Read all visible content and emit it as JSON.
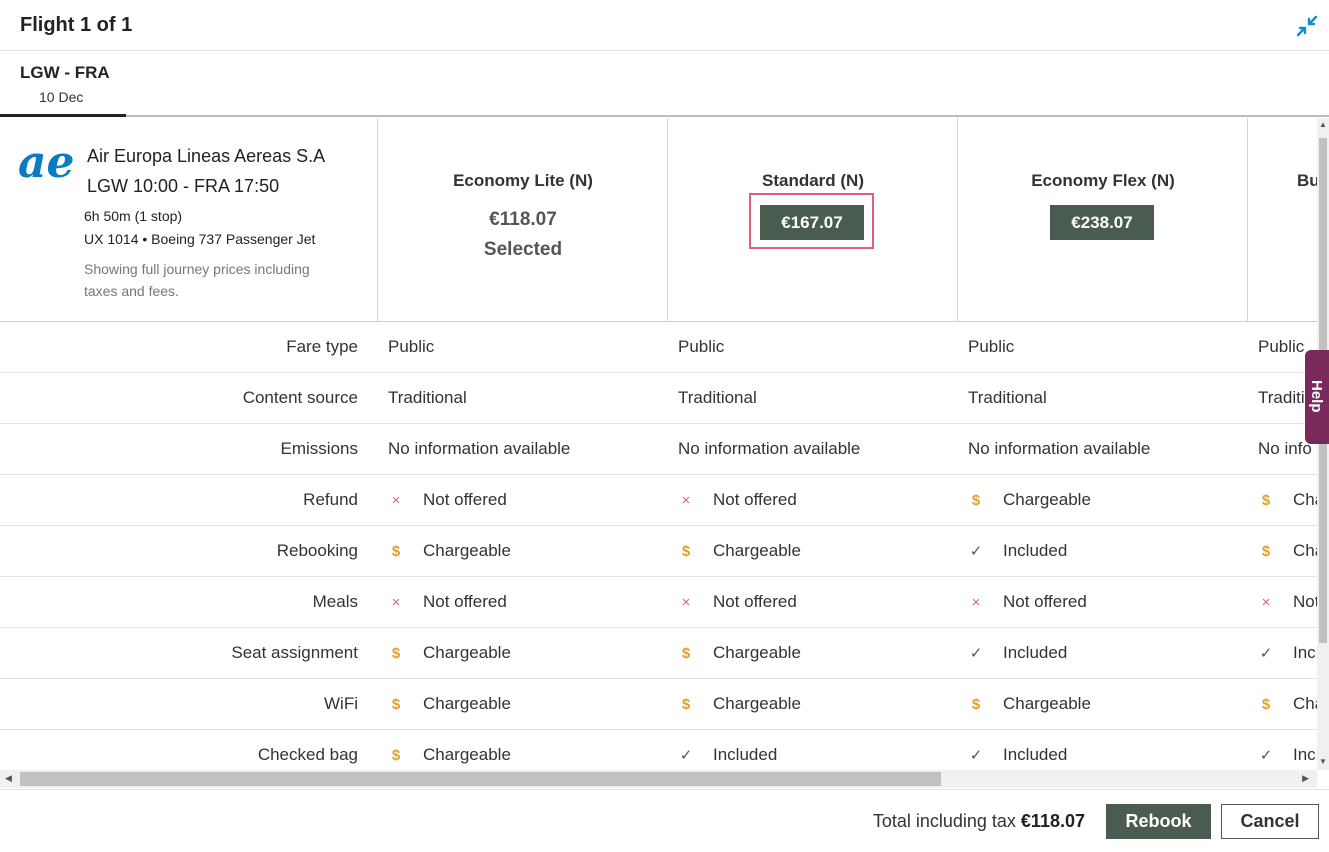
{
  "header": {
    "title": "Flight 1 of 1"
  },
  "tab": {
    "route": "LGW - FRA",
    "date": "10 Dec"
  },
  "flight": {
    "airline": "Air Europa Lineas Aereas S.A",
    "times": "LGW 10:00 - FRA 17:50",
    "duration": "6h 50m (1 stop)",
    "equipment": "UX 1014 • Boeing 737 Passenger Jet",
    "note": "Showing full journey prices including taxes and fees.",
    "logo_text": "ae",
    "logo_color": "#0a7cc4"
  },
  "fares": [
    {
      "name": "Economy Lite (N)",
      "price": "€118.07",
      "status": "Selected"
    },
    {
      "name": "Standard (N)",
      "price": "€167.07"
    },
    {
      "name": "Economy Flex (N)",
      "price": "€238.07"
    },
    {
      "name": "Bu"
    }
  ],
  "rows": [
    {
      "label": "Fare type",
      "cells": [
        {
          "icon": "",
          "text": "Public"
        },
        {
          "icon": "",
          "text": "Public"
        },
        {
          "icon": "",
          "text": "Public"
        },
        {
          "icon": "",
          "text": "Public"
        }
      ]
    },
    {
      "label": "Content source",
      "cells": [
        {
          "icon": "",
          "text": "Traditional"
        },
        {
          "icon": "",
          "text": "Traditional"
        },
        {
          "icon": "",
          "text": "Traditional"
        },
        {
          "icon": "",
          "text": "Traditi"
        }
      ]
    },
    {
      "label": "Emissions",
      "cells": [
        {
          "icon": "",
          "text": "No information available"
        },
        {
          "icon": "",
          "text": "No information available"
        },
        {
          "icon": "",
          "text": "No information available"
        },
        {
          "icon": "",
          "text": "No info"
        }
      ]
    },
    {
      "label": "Refund",
      "cells": [
        {
          "icon": "x",
          "text": "Not offered"
        },
        {
          "icon": "x",
          "text": "Not offered"
        },
        {
          "icon": "d",
          "text": "Chargeable"
        },
        {
          "icon": "d",
          "text": "Cha"
        }
      ]
    },
    {
      "label": "Rebooking",
      "cells": [
        {
          "icon": "d",
          "text": "Chargeable"
        },
        {
          "icon": "d",
          "text": "Chargeable"
        },
        {
          "icon": "c",
          "text": "Included"
        },
        {
          "icon": "d",
          "text": "Cha"
        }
      ]
    },
    {
      "label": "Meals",
      "cells": [
        {
          "icon": "x",
          "text": "Not offered"
        },
        {
          "icon": "x",
          "text": "Not offered"
        },
        {
          "icon": "x",
          "text": "Not offered"
        },
        {
          "icon": "x",
          "text": "Not"
        }
      ]
    },
    {
      "label": "Seat assignment",
      "cells": [
        {
          "icon": "d",
          "text": "Chargeable"
        },
        {
          "icon": "d",
          "text": "Chargeable"
        },
        {
          "icon": "c",
          "text": "Included"
        },
        {
          "icon": "c",
          "text": "Inc"
        }
      ]
    },
    {
      "label": "WiFi",
      "cells": [
        {
          "icon": "d",
          "text": "Chargeable"
        },
        {
          "icon": "d",
          "text": "Chargeable"
        },
        {
          "icon": "d",
          "text": "Chargeable"
        },
        {
          "icon": "d",
          "text": "Cha"
        }
      ]
    },
    {
      "label": "Checked bag",
      "cells": [
        {
          "icon": "d",
          "text": "Chargeable"
        },
        {
          "icon": "c",
          "text": "Included"
        },
        {
          "icon": "c",
          "text": "Included"
        },
        {
          "icon": "c",
          "text": "Inc"
        }
      ]
    }
  ],
  "icons": {
    "x": "×",
    "d": "$",
    "c": "✓"
  },
  "help": {
    "label": "Help"
  },
  "footer": {
    "total_label": "Total including tax",
    "total_value": "€118.07",
    "rebook_label": "Rebook",
    "cancel_label": "Cancel"
  },
  "colors": {
    "accent": "#4a5c50",
    "highlight": "#e0607a",
    "help": "#7a2a5a"
  }
}
